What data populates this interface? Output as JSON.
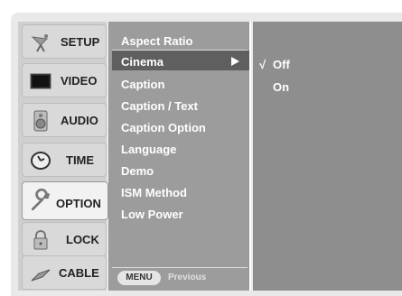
{
  "tabs": [
    {
      "label": "SETUP",
      "icon": "satellite-dish-icon"
    },
    {
      "label": "VIDEO",
      "icon": "monitor-icon"
    },
    {
      "label": "AUDIO",
      "icon": "speaker-icon"
    },
    {
      "label": "TIME",
      "icon": "clock-icon"
    },
    {
      "label": "OPTION",
      "icon": "wrench-icon",
      "active": true
    },
    {
      "label": "LOCK",
      "icon": "padlock-icon"
    },
    {
      "label": "CABLE",
      "icon": "cable-icon"
    }
  ],
  "menu": {
    "items": [
      {
        "label": "Aspect Ratio"
      },
      {
        "label": "Cinema",
        "selected": true
      },
      {
        "label": "Caption"
      },
      {
        "label": "Caption / Text"
      },
      {
        "label": "Caption Option"
      },
      {
        "label": "Language"
      },
      {
        "label": "Demo"
      },
      {
        "label": "ISM Method"
      },
      {
        "label": "Low Power"
      }
    ],
    "footer": {
      "menu_button": "MENU",
      "previous_label": "Previous"
    }
  },
  "submenu": {
    "options": [
      {
        "label": "Off",
        "checked": true,
        "check_mark": "√"
      },
      {
        "label": "On",
        "checked": false
      }
    ]
  },
  "colors": {
    "frame": "#e9e9e9",
    "sidebar": "#cfcfcf",
    "menu_bg": "#9c9c9c",
    "highlight": "#5f5f5f",
    "submenu_bg": "#8e8e8e",
    "text_light": "#ffffff"
  }
}
